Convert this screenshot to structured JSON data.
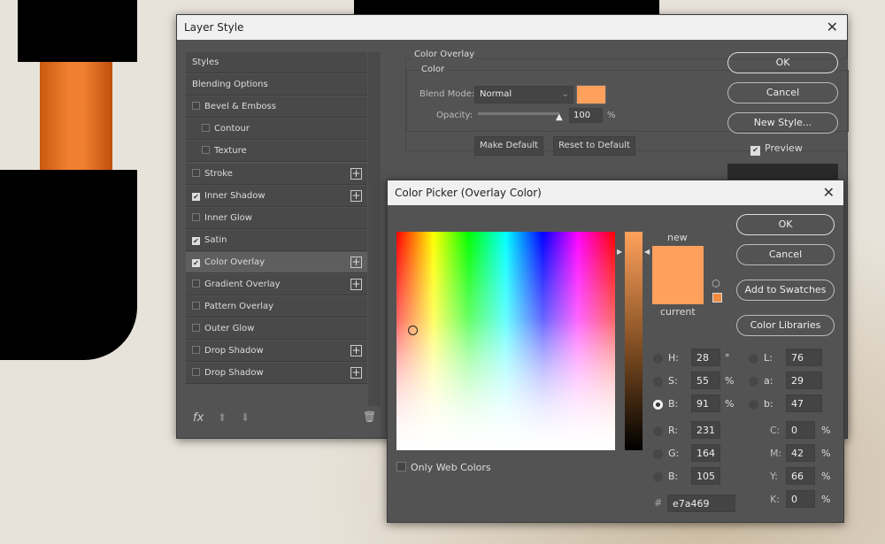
{
  "layer_style": {
    "title": "Layer Style",
    "items": [
      {
        "label": "Styles",
        "checkbox": null,
        "plus": false
      },
      {
        "label": "Blending Options",
        "checkbox": null,
        "plus": false
      },
      {
        "label": "Bevel & Emboss",
        "checkbox": false,
        "plus": false
      },
      {
        "label": "Contour",
        "checkbox": false,
        "plus": false,
        "indent": true
      },
      {
        "label": "Texture",
        "checkbox": false,
        "plus": false,
        "indent": true
      },
      {
        "label": "Stroke",
        "checkbox": false,
        "plus": true
      },
      {
        "label": "Inner Shadow",
        "checkbox": true,
        "plus": true
      },
      {
        "label": "Inner Glow",
        "checkbox": false,
        "plus": false
      },
      {
        "label": "Satin",
        "checkbox": true,
        "plus": false
      },
      {
        "label": "Color Overlay",
        "checkbox": true,
        "plus": true,
        "selected": true
      },
      {
        "label": "Gradient Overlay",
        "checkbox": false,
        "plus": true
      },
      {
        "label": "Pattern Overlay",
        "checkbox": false,
        "plus": false
      },
      {
        "label": "Outer Glow",
        "checkbox": false,
        "plus": false
      },
      {
        "label": "Drop Shadow",
        "checkbox": false,
        "plus": true
      },
      {
        "label": "Drop Shadow",
        "checkbox": false,
        "plus": true
      }
    ],
    "fx_label": "fx",
    "group_title": "Color Overlay",
    "sub_title": "Color",
    "blend_mode_label": "Blend Mode:",
    "blend_mode": "Normal",
    "opacity_label": "Opacity:",
    "opacity": "100",
    "opacity_unit": "%",
    "overlay_color": "#ffa15c",
    "make_default": "Make Default",
    "reset_default": "Reset to Default",
    "ok": "OK",
    "cancel": "Cancel",
    "new_style": "New Style...",
    "preview": "Preview",
    "preview_checked": true
  },
  "color_picker": {
    "title": "Color Picker (Overlay Color)",
    "ok": "OK",
    "cancel": "Cancel",
    "add_swatches": "Add to Swatches",
    "libraries": "Color Libraries",
    "new_label": "new",
    "current_label": "current",
    "new_color": "#ffa15c",
    "current_color": "#ffa15c",
    "only_web": "Only Web Colors",
    "H": "28",
    "S": "55",
    "B": "91",
    "R": "231",
    "G": "164",
    "Bv": "105",
    "L": "76",
    "a": "29",
    "b": "47",
    "C": "0",
    "M": "42",
    "Y": "66",
    "K": "0",
    "hex": "e7a469",
    "deg": "°",
    "pct": "%",
    "hash": "#",
    "selected_mode": "B"
  }
}
